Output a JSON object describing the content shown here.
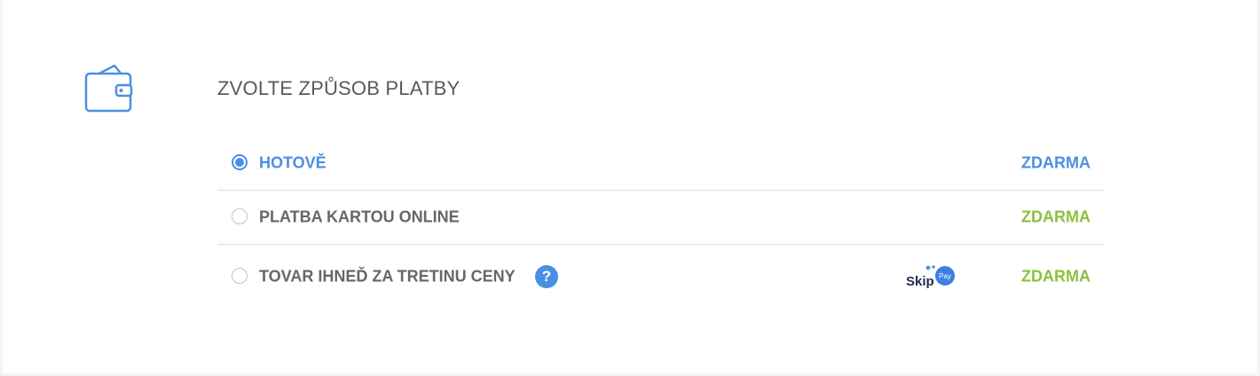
{
  "section": {
    "title": "ZVOLTE ZPŮSOB PLATBY",
    "icon": "wallet-icon"
  },
  "colors": {
    "accent": "#4a90e2",
    "free": "#8cbf3f",
    "text": "#666666"
  },
  "payment_options": [
    {
      "label": "HOTOVĚ",
      "price": "ZDARMA",
      "selected": true
    },
    {
      "label": "PLATBA KARTOU ONLINE",
      "price": "ZDARMA",
      "selected": false
    },
    {
      "label": "TOVAR IHNEĎ ZA TRETINU CENY",
      "price": "ZDARMA",
      "selected": false,
      "help_icon": "?",
      "logo": {
        "word": "Skip",
        "badge": "Pay"
      }
    }
  ]
}
